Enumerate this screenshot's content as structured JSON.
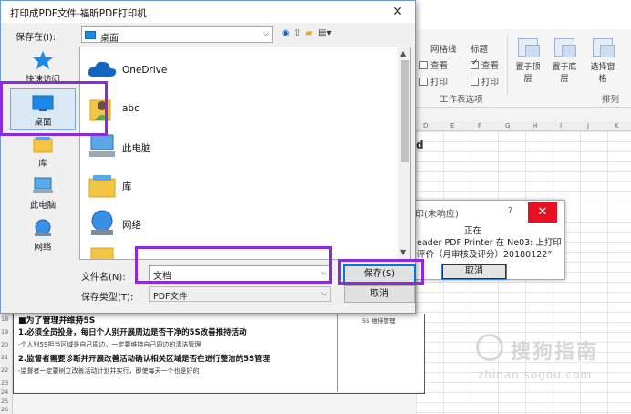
{
  "dialog": {
    "title": "打印成PDF文件-福昕PDF打印机",
    "close_glyph": "✕",
    "save_in_label": "保存在(I):",
    "save_in_value": "桌面",
    "places": [
      {
        "label": "快速访问"
      },
      {
        "label": "桌面"
      },
      {
        "label": "库"
      },
      {
        "label": "此电脑"
      },
      {
        "label": "网络"
      }
    ],
    "files": [
      {
        "name": "OneDrive"
      },
      {
        "name": "abc"
      },
      {
        "name": "此电脑"
      },
      {
        "name": "库"
      },
      {
        "name": "网络"
      }
    ],
    "filename_label": "文件名(N):",
    "filename_value": "文档",
    "filetype_label": "保存类型(T):",
    "filetype_value": "PDF文件",
    "save_button": "保存(S)",
    "cancel_button": "取消"
  },
  "not_responding": {
    "title": "印(未响应)",
    "question": "?",
    "close_glyph": "✕",
    "line1": "正在",
    "line2": "eader PDF Printer 在 Ne03: 上打印",
    "line3": "评价（月审核及评分）20180122”",
    "cancel_button": "取消"
  },
  "ribbon": {
    "col1_head": "网格线",
    "col2_head": "标题",
    "view1": "查看",
    "view2": "查看",
    "print1": "打印",
    "print2": "打印",
    "group_label": "工作表选项",
    "btn_front": "置于顶层",
    "btn_back": "置于底层",
    "btn_pane": "选择窗格",
    "arrange_label": "排列"
  },
  "sheet": {
    "col_letters": [
      "D",
      "E",
      "F",
      "G",
      "H",
      "I",
      "J",
      "K"
    ],
    "row_numbers": [
      "18",
      "19",
      "20",
      "21",
      "22",
      "23",
      "24",
      "25",
      "26"
    ],
    "title_row": "■为了管理并维持5S",
    "item1": "1.必须全员投身，每日个人别开展周边是否干净的5S改善推持活动",
    "item1_sub": "-个人别5S担当区域是自己周边，一定要维持自己周边的清洁管理",
    "item2": "2.监督者需要诊断并开展改善活动确认相关区域是否在进行整洁的5S管理",
    "item2_sub": "-监督者一定要树立改善活动计划并实行，即使每天一个也是好的",
    "right_note": "5S 维持管理",
    "edge_char": "d"
  },
  "watermark": {
    "text": "搜狗指南",
    "sub": "zhinan.sogou.com"
  },
  "colors": {
    "highlight": "#8a2be2",
    "close_red": "#e81123",
    "accent": "#0078d7"
  }
}
